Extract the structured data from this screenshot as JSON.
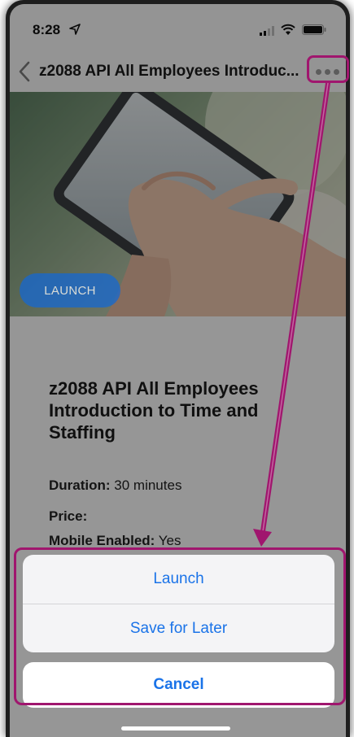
{
  "status_bar": {
    "time": "8:28",
    "icons": [
      "location-arrow-icon",
      "signal-icon",
      "wifi-icon",
      "battery-icon"
    ]
  },
  "nav": {
    "title": "z2088 API All Employees Introduc...",
    "back_icon": "chevron-left-icon",
    "more_icon": "ellipsis-icon"
  },
  "hero": {
    "launch_label": "LAUNCH"
  },
  "course": {
    "title": "z2088 API All Employees Introduction to Time and Staffing",
    "duration_label": "Duration:",
    "duration_value": "30 minutes",
    "price_label": "Price:",
    "price_value": "",
    "mobile_label": "Mobile Enabled:",
    "mobile_value": "Yes"
  },
  "action_sheet": {
    "items": [
      "Launch",
      "Save for Later"
    ],
    "cancel": "Cancel"
  },
  "colors": {
    "accent": "#1a73e8",
    "launch_pill": "#1668d1",
    "annotation": "#a0166e"
  }
}
